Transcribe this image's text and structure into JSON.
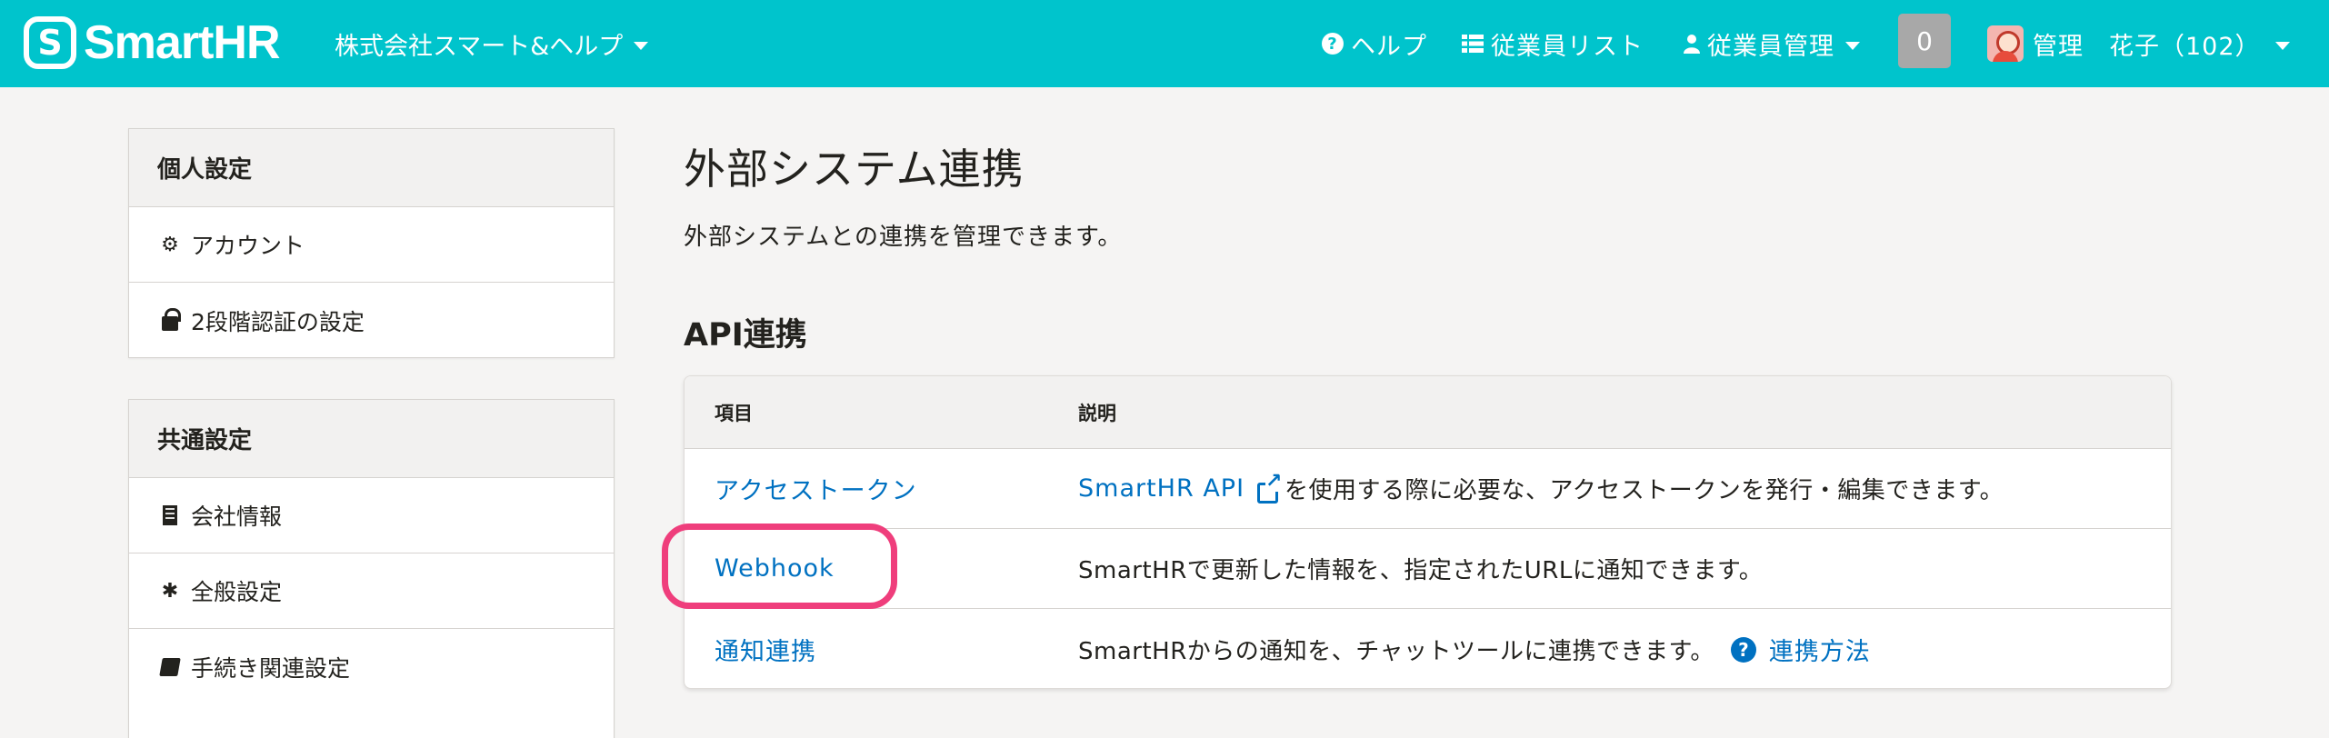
{
  "header": {
    "brand": "SmartHR",
    "company": "株式会社スマート&ヘルプ",
    "nav": {
      "help": "ヘルプ",
      "employee_list": "従業員リスト",
      "employee_manage": "従業員管理"
    },
    "notification_count": "0",
    "user_name": "管理　花子（102）"
  },
  "sidebar": {
    "personal": {
      "heading": "個人設定",
      "items": [
        {
          "label": "アカウント",
          "icon": "gear-icon"
        },
        {
          "label": "2段階認証の設定",
          "icon": "lock-icon"
        }
      ]
    },
    "common": {
      "heading": "共通設定",
      "items": [
        {
          "label": "会社情報",
          "icon": "building-icon"
        },
        {
          "label": "全般設定",
          "icon": "asterisk-icon"
        },
        {
          "label": "手続き関連設定",
          "icon": "book-icon"
        }
      ]
    }
  },
  "main": {
    "title": "外部システム連携",
    "description": "外部システムとの連携を管理できます。",
    "section_title": "API連携",
    "table": {
      "headers": [
        "項目",
        "説明"
      ],
      "rows": [
        {
          "item": "アクセストークン",
          "desc_link": "SmartHR API",
          "desc": "を使用する際に必要な、アクセストークンを発行・編集できます。"
        },
        {
          "item": "Webhook",
          "desc": "SmartHRで更新した情報を、指定されたURLに通知できます。"
        },
        {
          "item": "通知連携",
          "desc": "SmartHRからの通知を、チャットツールに連携できます。",
          "help_link": "連携方法"
        }
      ]
    }
  },
  "colors": {
    "header_bg": "#00c4cc",
    "link": "#0071c1",
    "highlight": "#ef3e7c",
    "page_bg": "#f5f4f3"
  }
}
